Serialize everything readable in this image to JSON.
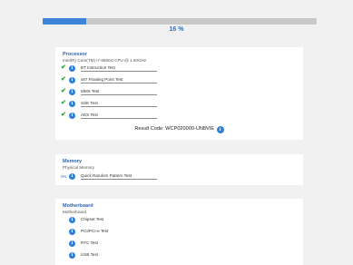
{
  "progress": {
    "percent_text": "16 %",
    "fraction": 0.16
  },
  "processor": {
    "title": "Processor",
    "subtitle": "Intel(R) Core(TM) i7-8650U CPU @ 1.90GHz",
    "tests": [
      {
        "label": "BT Instruction Test",
        "status": "passed"
      },
      {
        "label": "x87 Floating Point Test",
        "status": "passed"
      },
      {
        "label": "MMX Test",
        "status": "passed"
      },
      {
        "label": "SSE Test",
        "status": "passed"
      },
      {
        "label": "AES Test",
        "status": "passed"
      }
    ],
    "result_code": "Result Code: WCP020000-UN8VIE"
  },
  "memory": {
    "title": "Memory",
    "subtitle": "Physical Memory",
    "tests": [
      {
        "label": "Quick Random Pattern Test",
        "status": "running",
        "percent": "0%"
      }
    ]
  },
  "motherboard": {
    "title": "Motherboard",
    "subtitle": "Motherboard",
    "tests": [
      {
        "label": "Chipset Test",
        "status": "pending"
      },
      {
        "label": "PCI/PCI-e Test",
        "status": "pending"
      },
      {
        "label": "RTC Test",
        "status": "pending"
      },
      {
        "label": "USB Test",
        "status": "pending"
      }
    ]
  },
  "icons": {
    "passed": "checkmark-icon",
    "info": "info-icon"
  },
  "colors": {
    "accent": "#3d83d8",
    "pass": "#2e9e33",
    "title": "#2a64b8"
  }
}
